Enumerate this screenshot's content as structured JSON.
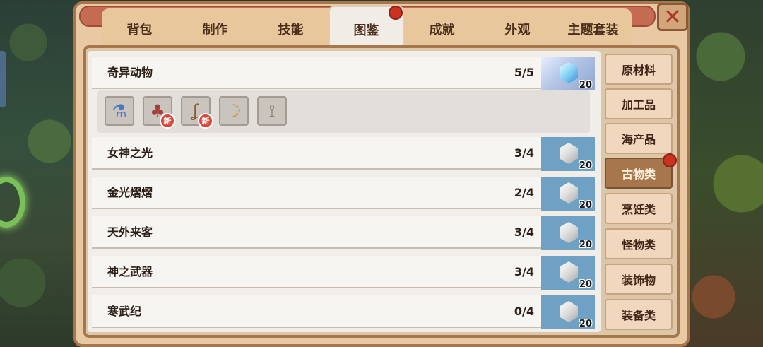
{
  "tabs": [
    {
      "label": "背包"
    },
    {
      "label": "制作"
    },
    {
      "label": "技能"
    },
    {
      "label": "图鉴"
    },
    {
      "label": "成就"
    },
    {
      "label": "外观"
    },
    {
      "label": "主题套装"
    }
  ],
  "active_tab": "图鉴",
  "close_label": "✕",
  "collections": [
    {
      "name": "奇异动物",
      "progress": "5/5",
      "reward_qty": "20"
    },
    {
      "name": "女神之光",
      "progress": "3/4",
      "reward_qty": "20"
    },
    {
      "name": "金光熠熠",
      "progress": "2/4",
      "reward_qty": "20"
    },
    {
      "name": "天外来客",
      "progress": "3/4",
      "reward_qty": "20"
    },
    {
      "name": "神之武器",
      "progress": "3/4",
      "reward_qty": "20"
    },
    {
      "name": "寒武纪",
      "progress": "0/4",
      "reward_qty": "20"
    }
  ],
  "expanded_items": [
    {
      "icon": "potion-jar-icon",
      "glyph": "⚗",
      "color": "#4a78c8",
      "new": false
    },
    {
      "icon": "brain-coral-icon",
      "glyph": "♣",
      "color": "#a8403a",
      "new": true,
      "badge": "新"
    },
    {
      "icon": "hook-tail-icon",
      "glyph": "ʆ",
      "color": "#8a5a2a",
      "new": true,
      "badge": "新"
    },
    {
      "icon": "horn-icon",
      "glyph": "☽",
      "color": "#c89030",
      "new": false
    },
    {
      "icon": "bone-icon",
      "glyph": "⟟",
      "color": "#8a8270",
      "new": false
    }
  ],
  "categories": [
    {
      "label": "原材料"
    },
    {
      "label": "加工品"
    },
    {
      "label": "海产品"
    },
    {
      "label": "古物类"
    },
    {
      "label": "烹饪类"
    },
    {
      "label": "怪物类"
    },
    {
      "label": "装饰物"
    },
    {
      "label": "装备类"
    }
  ],
  "active_category": "古物类",
  "colors": {
    "accent": "#a7764c",
    "notification": "#c9331f",
    "reward_bg": "#6fa1c4"
  }
}
